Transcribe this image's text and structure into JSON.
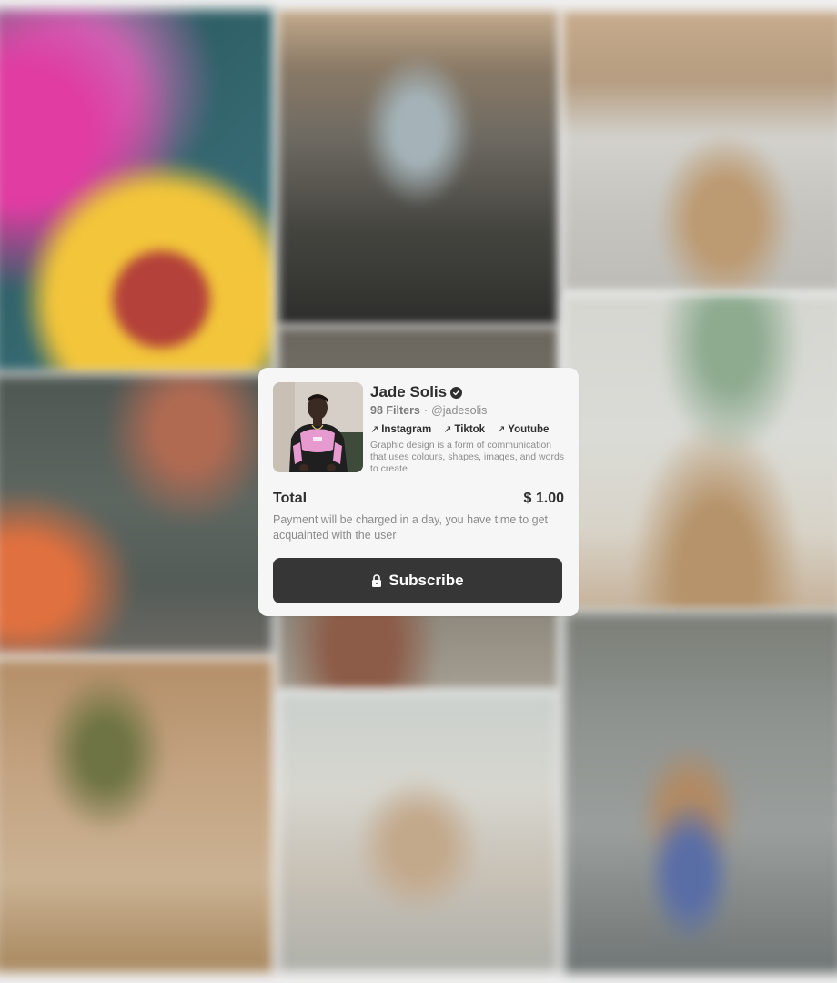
{
  "profile": {
    "name": "Jade Solis",
    "filters_count": "98 Filters",
    "separator": "·",
    "handle": "@jadesolis",
    "links": [
      {
        "label": "Instagram",
        "icon": "arrow-up-right-icon"
      },
      {
        "label": "Tiktok",
        "icon": "arrow-up-right-icon"
      },
      {
        "label": "Youtube",
        "icon": "arrow-up-right-icon"
      }
    ],
    "bio": "Graphic design is a form of communication that uses colours, shapes, images, and words to create.",
    "verified_icon": "verified-badge-icon"
  },
  "checkout": {
    "total_label": "Total",
    "total_value": "$ 1.00",
    "note": "Payment will be charged in a day, you have time to get acquainted with the user",
    "subscribe_label": "Subscribe",
    "subscribe_icon": "lock-icon"
  },
  "colors": {
    "background": "#efefef",
    "card": "#f6f6f6",
    "button": "#363636",
    "text_primary": "#2e2e2e",
    "text_secondary": "#8b8b8b"
  }
}
